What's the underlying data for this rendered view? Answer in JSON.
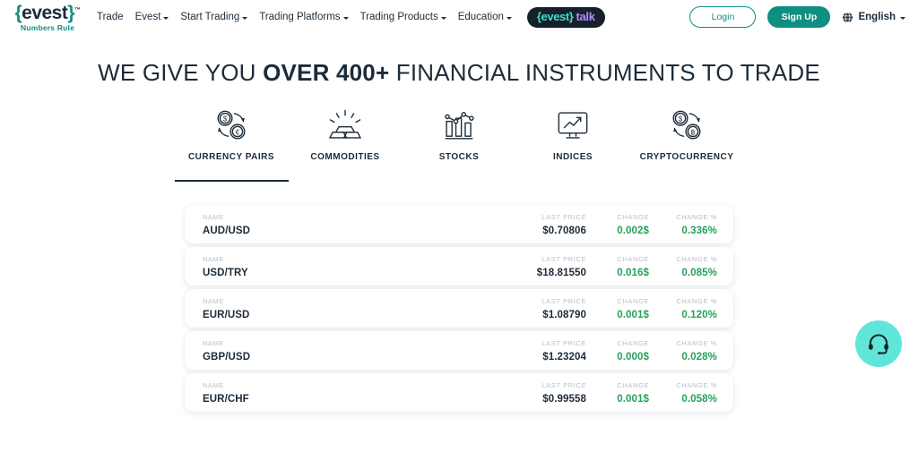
{
  "nav": {
    "logo": {
      "brace_open": "{",
      "word": "evest",
      "brace_close": "}",
      "tm": "™",
      "tagline": "Numbers Rule"
    },
    "links": [
      {
        "label": "Trade",
        "has_caret": false,
        "name": "nav-link-trade"
      },
      {
        "label": "Evest",
        "has_caret": true,
        "name": "nav-link-evest"
      },
      {
        "label": "Start Trading",
        "has_caret": true,
        "name": "nav-link-start-trading"
      },
      {
        "label": "Trading Platforms",
        "has_caret": true,
        "name": "nav-link-trading-platforms"
      },
      {
        "label": "Trading Products",
        "has_caret": true,
        "name": "nav-link-trading-products"
      },
      {
        "label": "Education",
        "has_caret": true,
        "name": "nav-link-education"
      }
    ],
    "talk_badge": {
      "brand": "{evest}",
      "word": "talk"
    },
    "login_label": "Login",
    "signup_label": "Sign Up",
    "language": "English"
  },
  "hero": {
    "headline_part1": "WE GIVE YOU ",
    "headline_strong": "OVER 400+",
    "headline_part2": " FINANCIAL INSTRUMENTS TO TRADE"
  },
  "categories": [
    {
      "label": "CURRENCY PAIRS",
      "icon": "currency-exchange-icon",
      "active": true
    },
    {
      "label": "COMMODITIES",
      "icon": "gold-bars-icon",
      "active": false
    },
    {
      "label": "STOCKS",
      "icon": "bar-chart-icon",
      "active": false
    },
    {
      "label": "INDICES",
      "icon": "monitor-chart-icon",
      "active": false
    },
    {
      "label": "CRYPTOCURRENCY",
      "icon": "crypto-exchange-icon",
      "active": false
    }
  ],
  "table": {
    "headers": {
      "name": "NAME",
      "last_price": "LAST PRICE",
      "change": "CHANGE",
      "change_pct": "CHANGE %"
    },
    "rows": [
      {
        "name": "AUD/USD",
        "last_price": "$0.70806",
        "change": "0.002$",
        "change_pct": "0.336%"
      },
      {
        "name": "USD/TRY",
        "last_price": "$18.81550",
        "change": "0.016$",
        "change_pct": "0.085%"
      },
      {
        "name": "EUR/USD",
        "last_price": "$1.08790",
        "change": "0.001$",
        "change_pct": "0.120%"
      },
      {
        "name": "GBP/USD",
        "last_price": "$1.23204",
        "change": "0.000$",
        "change_pct": "0.028%"
      },
      {
        "name": "EUR/CHF",
        "last_price": "$0.99558",
        "change": "0.001$",
        "change_pct": "0.058%"
      }
    ]
  },
  "support": {
    "icon": "headset-icon"
  },
  "colors": {
    "brand_teal": "#0e8f82",
    "dark_navy": "#1c2b39",
    "positive_green": "#25a25a",
    "fab_turquoise": "#5fe6d8",
    "muted_label": "#b9bfc6"
  }
}
